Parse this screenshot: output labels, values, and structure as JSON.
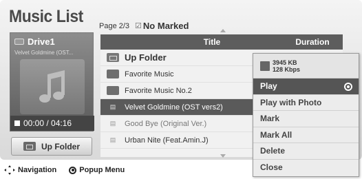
{
  "header": {
    "title": "Music List",
    "page": "Page 2/3",
    "marked": "No Marked"
  },
  "left_panel": {
    "drive": "Drive1",
    "track": "Velvet Goldmine (OST...",
    "time": "00:00 / 04:16",
    "up_folder_button": "Up Folder"
  },
  "list": {
    "columns": {
      "title": "Title",
      "duration": "Duration"
    },
    "rows": [
      {
        "label": "Up Folder",
        "icon": "up-folder-icon"
      },
      {
        "label": "Favorite Music",
        "icon": "folder-icon"
      },
      {
        "label": "Favorite Music No.2",
        "icon": "folder-icon"
      },
      {
        "label": "Velvet Goldmine (OST vers2)",
        "icon": "music-file-icon"
      },
      {
        "label": "Good Bye (Original Ver.)",
        "icon": "music-file-icon"
      },
      {
        "label": "Urban Nite (Feat.Amin.J)",
        "icon": "music-file-icon"
      }
    ]
  },
  "popup": {
    "size": "3945 KB",
    "bitrate": "128 Kbps",
    "items": [
      "Play",
      "Play with Photo",
      "Mark",
      "Mark All",
      "Delete",
      "Close"
    ]
  },
  "footer": {
    "navigation": "Navigation",
    "popup_menu": "Popup Menu"
  }
}
